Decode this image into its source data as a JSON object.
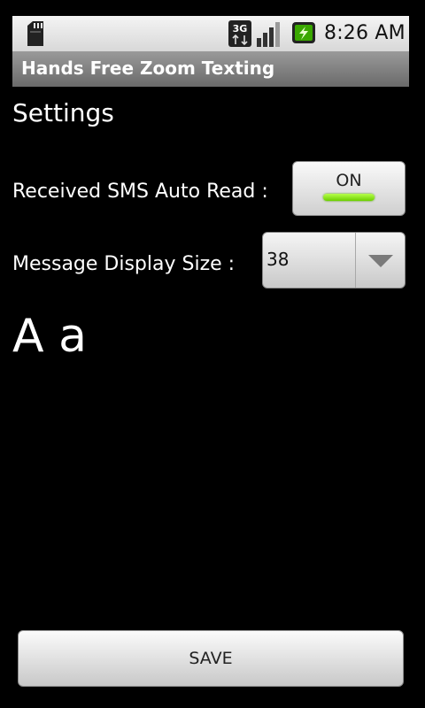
{
  "status_bar": {
    "time": "8:26 AM",
    "network_label": "3G",
    "icons": [
      "sd-card-icon",
      "network-3g-icon",
      "signal-strength-icon",
      "battery-charging-icon"
    ],
    "colors": {
      "battery_accent": "#3aa800"
    }
  },
  "title_bar": {
    "app_title": "Hands Free Zoom Texting"
  },
  "settings": {
    "heading": "Settings",
    "auto_read": {
      "label": "Received SMS Auto Read :",
      "toggle_text": "ON",
      "toggle_state": true,
      "indicator_color": "#7fe000"
    },
    "display_size": {
      "label": "Message Display Size :",
      "selected_value": "38",
      "icon": "dropdown-arrow-icon"
    },
    "sample_text": "A a"
  },
  "footer": {
    "save_label": "SAVE"
  }
}
